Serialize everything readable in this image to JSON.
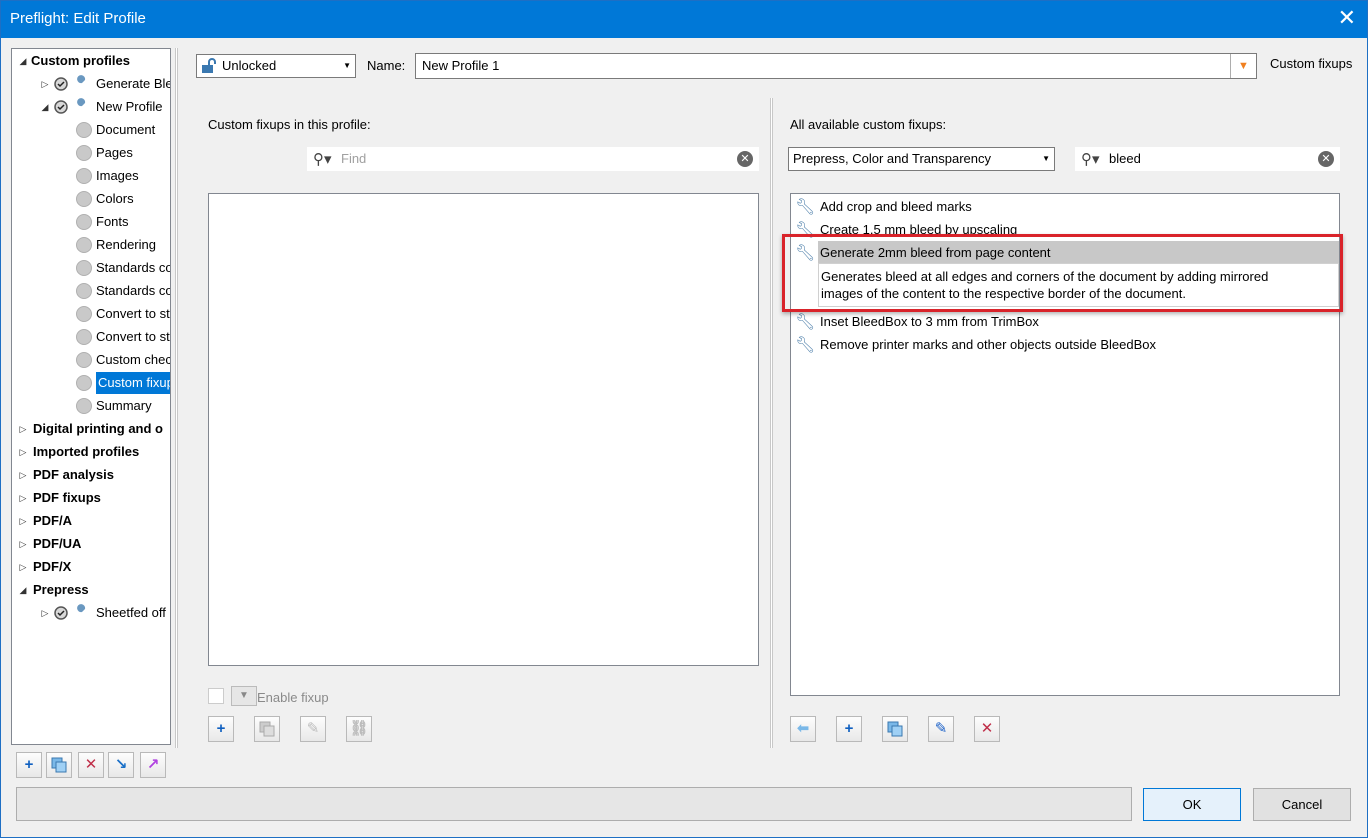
{
  "window": {
    "title": "Preflight: Edit Profile",
    "close_glyph": "✕"
  },
  "tree": {
    "items": [
      {
        "label": "Custom profiles",
        "bold": true,
        "expander": "◢"
      },
      {
        "label": "Generate Ble",
        "expander": "▷",
        "icon": "check-wrench-icon"
      },
      {
        "label": "New Profile",
        "expander": "◢",
        "icon": "check-wrench-icon"
      },
      {
        "label": "Document"
      },
      {
        "label": "Pages"
      },
      {
        "label": "Images"
      },
      {
        "label": "Colors"
      },
      {
        "label": "Fonts"
      },
      {
        "label": "Rendering"
      },
      {
        "label": "Standards co"
      },
      {
        "label": "Standards co"
      },
      {
        "label": "Convert to st"
      },
      {
        "label": "Convert to st"
      },
      {
        "label": "Custom chec"
      },
      {
        "label": "Custom fixup",
        "selected": true
      },
      {
        "label": "Summary"
      },
      {
        "label": "Digital printing and o",
        "bold": true,
        "expander": "▷"
      },
      {
        "label": "Imported profiles",
        "bold": true,
        "expander": "▷"
      },
      {
        "label": "PDF analysis",
        "bold": true,
        "expander": "▷"
      },
      {
        "label": "PDF fixups",
        "bold": true,
        "expander": "▷"
      },
      {
        "label": "PDF/A",
        "bold": true,
        "expander": "▷"
      },
      {
        "label": "PDF/UA",
        "bold": true,
        "expander": "▷"
      },
      {
        "label": "PDF/X",
        "bold": true,
        "expander": "▷"
      },
      {
        "label": "Prepress",
        "bold": true,
        "expander": "◢"
      },
      {
        "label": "Sheetfed off",
        "expander": "▷",
        "icon": "lock-wrench-icon"
      }
    ],
    "buttons": [
      "add-icon",
      "duplicate-icon",
      "delete-icon",
      "import-icon",
      "export-icon"
    ]
  },
  "header": {
    "lock_value": "Unlocked",
    "name_label": "Name:",
    "name_value": "New Profile 1",
    "section_title": "Custom fixups"
  },
  "left_panel": {
    "title": "Custom fixups in this profile:",
    "search_placeholder": "Find",
    "enable_label": "Enable fixup",
    "buttons": [
      "add-icon",
      "duplicate-icon",
      "edit-icon",
      "link-icon"
    ]
  },
  "right_panel": {
    "title": "All available custom fixups:",
    "category": "Prepress, Color and Transparency",
    "search_value": "bleed",
    "items": [
      {
        "label": "Add crop and bleed marks"
      },
      {
        "label": "Create 1.5 mm bleed by upscaling"
      },
      {
        "label": "Generate 2mm bleed from page content",
        "selected": true,
        "description_line1": "Generates bleed at all edges and corners of the document by adding mirrored",
        "description_line2": "images of the content to the respective border of the document."
      },
      {
        "label": "Inset BleedBox to 3 mm from TrimBox"
      },
      {
        "label": "Remove printer marks and other objects outside BleedBox"
      }
    ],
    "buttons": [
      "arrow-left-icon",
      "add-icon",
      "duplicate-icon",
      "edit-icon",
      "delete-icon"
    ]
  },
  "footer": {
    "ok_label": "OK",
    "cancel_label": "Cancel"
  },
  "colors": {
    "accent": "#0078d7",
    "highlight_box": "#d9232a",
    "selected_row": "#c8c8c8"
  }
}
